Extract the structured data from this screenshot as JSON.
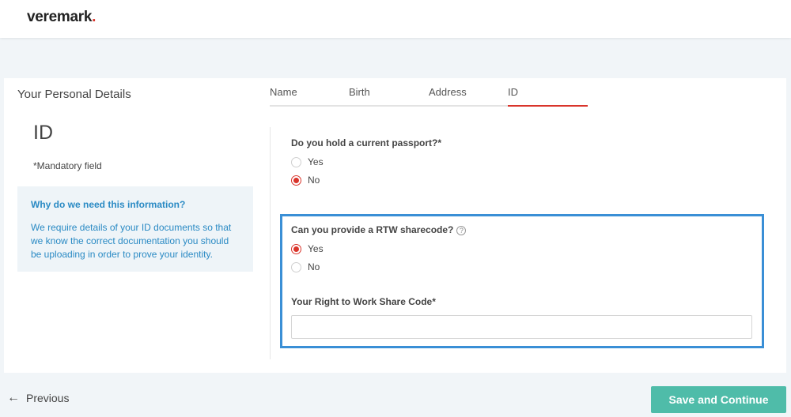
{
  "header": {
    "logo_text": "veremark",
    "logo_dot": "."
  },
  "left_panel": {
    "section_title": "Your Personal Details",
    "heading": "ID",
    "mandatory_note": "*Mandatory field",
    "info": {
      "title": "Why do we need this information?",
      "text": "We require details of your ID documents so that we know the correct documentation you should be uploading in order to prove your identity."
    }
  },
  "tabs": [
    {
      "label": "Name",
      "active": false
    },
    {
      "label": "Birth",
      "active": false
    },
    {
      "label": "Address",
      "active": false
    },
    {
      "label": "ID",
      "active": true
    }
  ],
  "form": {
    "passport": {
      "label": "Do you hold a current passport?*",
      "options": [
        {
          "label": "Yes",
          "checked": false
        },
        {
          "label": "No",
          "checked": true
        }
      ]
    },
    "rtw": {
      "label": "Can you provide a RTW sharecode?",
      "help_icon": "?",
      "options": [
        {
          "label": "Yes",
          "checked": true
        },
        {
          "label": "No",
          "checked": false
        }
      ]
    },
    "share_code": {
      "label": "Your Right to Work Share Code*",
      "value": "",
      "placeholder": ""
    }
  },
  "footer": {
    "previous_arrow": "←",
    "previous_label": "Previous",
    "save_label": "Save and Continue"
  },
  "colors": {
    "accent_red": "#d9342b",
    "highlight_blue": "#3a8fd6",
    "button_teal": "#4fbca9",
    "info_blue": "#2a8ac4"
  }
}
